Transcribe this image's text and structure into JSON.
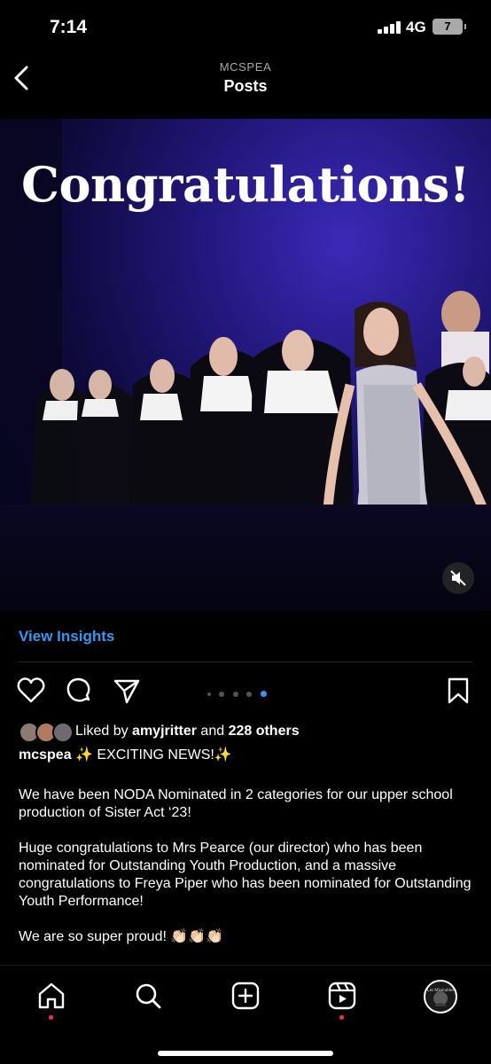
{
  "status_bar": {
    "time": "7:14",
    "network": "4G",
    "battery": "7"
  },
  "header": {
    "account": "MCSPEA",
    "title": "Posts"
  },
  "post": {
    "image_headline": "Congratulations!",
    "view_insights": "View Insights",
    "carousel": {
      "count": 5,
      "active_index": 4
    },
    "likes": {
      "prefix": "Liked by ",
      "user": "amyjritter",
      "middle": " and ",
      "others": "228 others"
    },
    "caption": {
      "username": "mcspea",
      "first_line": " ✨ EXCITING NEWS!✨",
      "paragraphs": [
        "We have been NODA Nominated in 2 categories for our upper school production of Sister Act ‘23!",
        "Huge congratulations to Mrs Pearce (our director) who has been nominated for Outstanding Youth Production, and a massive congratulations to Freya Piper who has been nominated for Outstanding Youth Performance!",
        "We are so super proud! 👏🏻👏🏻👏🏻"
      ]
    }
  },
  "bottom_nav": {
    "tabs": [
      "home",
      "search",
      "create",
      "reels",
      "profile"
    ],
    "profile_avatar_text": "Les Misérables"
  },
  "colors": {
    "accent": "#3897f0",
    "notification": "#ff3040",
    "background": "#000000"
  }
}
